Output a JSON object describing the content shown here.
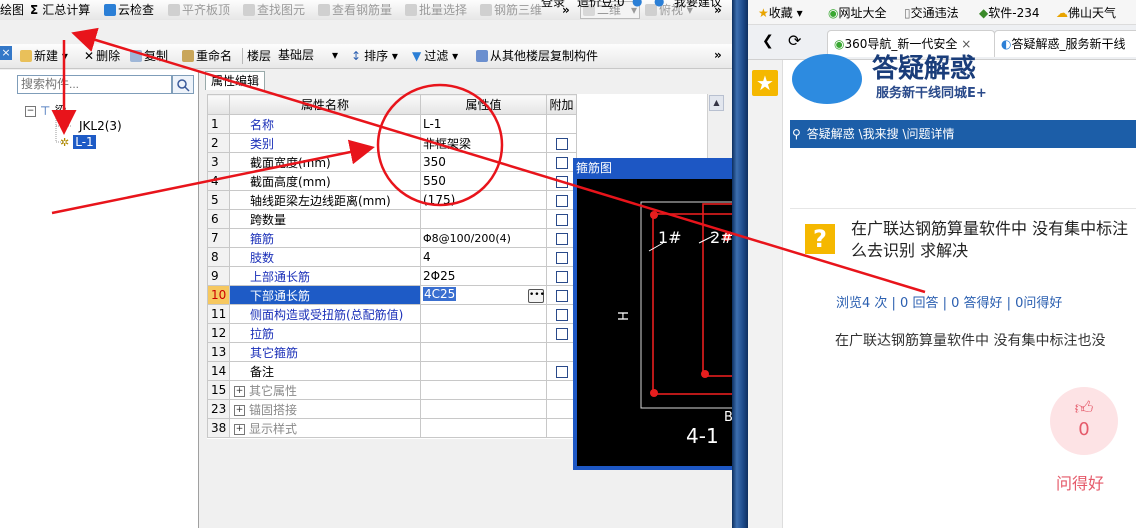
{
  "toolbar1": {
    "draw": "绘图",
    "sum": "汇总计算",
    "cloud": "云检查",
    "flat": "平齐板顶",
    "find": "查找图元",
    "viewrebar": "查看钢筋量",
    "batch": "批量选择",
    "rebar3d": "钢筋三维",
    "view2d": "二维",
    "top": "俯视",
    "login": "登录",
    "price": "造价豆:0",
    "suggest": "我要建议"
  },
  "toolbar2": {
    "new": "新建",
    "delete": "删除",
    "copy": "复制",
    "rename": "重命名",
    "floor": "楼层",
    "base": "基础层",
    "sort": "排序",
    "filter": "过滤",
    "copyfrom": "从其他楼层复制构件"
  },
  "tree": {
    "search_placeholder": "搜索构件...",
    "root": "梁",
    "items": [
      "JKL2(3)",
      "L-1"
    ]
  },
  "props": {
    "tab": "属性编辑",
    "col_name": "属性名称",
    "col_value": "属性值",
    "col_extra": "附加",
    "rows": [
      {
        "n": "1",
        "name": "名称",
        "value": "L-1"
      },
      {
        "n": "2",
        "name": "类别",
        "value": "非框架梁"
      },
      {
        "n": "3",
        "name": "截面宽度(mm)",
        "value": "350"
      },
      {
        "n": "4",
        "name": "截面高度(mm)",
        "value": "550"
      },
      {
        "n": "5",
        "name": "轴线距梁左边线距离(mm)",
        "value": "(175)"
      },
      {
        "n": "6",
        "name": "跨数量",
        "value": ""
      },
      {
        "n": "7",
        "name": "箍筋",
        "value": "Φ8@100/200(4)"
      },
      {
        "n": "8",
        "name": "肢数",
        "value": "4"
      },
      {
        "n": "9",
        "name": "上部通长筋",
        "value": "2Φ25"
      },
      {
        "n": "10",
        "name": "下部通长筋",
        "value": "4C25"
      },
      {
        "n": "11",
        "name": "侧面构造或受扭筋(总配筋值)",
        "value": ""
      },
      {
        "n": "12",
        "name": "拉筋",
        "value": ""
      },
      {
        "n": "13",
        "name": "其它箍筋",
        "value": ""
      },
      {
        "n": "14",
        "name": "备注",
        "value": ""
      },
      {
        "n": "15",
        "name": "其它属性",
        "value": ""
      },
      {
        "n": "23",
        "name": "锚固搭接",
        "value": ""
      },
      {
        "n": "38",
        "name": "显示样式",
        "value": ""
      }
    ]
  },
  "stirrup": {
    "title": "箍筋图",
    "label1": "1#",
    "label2": "2#",
    "h": "H",
    "b": "B",
    "count": "4-1"
  },
  "browser": {
    "bookmarks": [
      "收藏",
      "网址大全",
      "交通违法",
      "软件-234",
      "佛山天气"
    ],
    "tab1": "360导航_新一代安全",
    "tab2": "答疑解惑_服务新干线",
    "site_title": "答疑解惑",
    "site_sub": "服务新干线同城E+",
    "breadcrumb": "答疑解惑 \\我来搜 \\问题详情",
    "question": "在广联达钢筋算量软件中 没有集中标注 么去识别 求解决",
    "stats": "浏览4 次 | 0 回答 | 0 答得好 | 0问得好",
    "body": "在广联达钢筋算量软件中 没有集中标注也没",
    "likes": "0",
    "like_label": "问得好"
  },
  "colors": {
    "annotation": "#e8141b",
    "accent_blue": "#1c5ea8",
    "highlight": "#f6c860"
  }
}
